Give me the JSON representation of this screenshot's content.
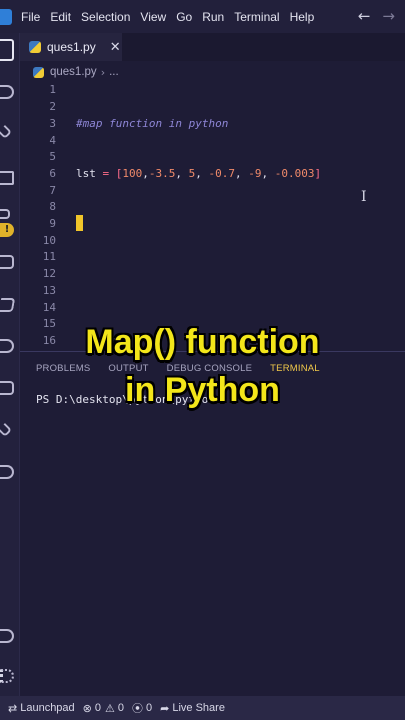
{
  "menubar": {
    "items": [
      "File",
      "Edit",
      "Selection",
      "View",
      "Go",
      "Run",
      "Terminal",
      "Help"
    ],
    "back_icon": "arrow-left-icon",
    "forward_icon": "arrow-right-icon"
  },
  "tab": {
    "label": "ques1.py",
    "close": "✕"
  },
  "breadcrumb": {
    "file": "ques1.py",
    "sep": "›",
    "more": "..."
  },
  "editor": {
    "line_numbers": [
      "1",
      "2",
      "3",
      "4",
      "5",
      "6",
      "7",
      "8",
      "9",
      "10",
      "11",
      "12",
      "13",
      "14",
      "15",
      "16"
    ],
    "line3_comment": "#map function in python",
    "line6": {
      "var": "lst",
      "op": " = ",
      "open": "[",
      "values": [
        "100",
        "-3.5",
        "5",
        "-0.7",
        "-9",
        "-0.003"
      ],
      "close": "]"
    }
  },
  "overlay": {
    "line1": "Map() function",
    "line2": "in Python"
  },
  "panel": {
    "tabs": [
      "PROBLEMS",
      "OUTPUT",
      "DEBUG CONSOLE",
      "TERMINAL"
    ],
    "active_tab": "TERMINAL",
    "terminal_text": "PS D:\\desktop\\python\\python>"
  },
  "statusbar": {
    "launchpad": "Launchpad",
    "errors": "0",
    "warnings": "0",
    "ports": "0",
    "live_share": "Live Share"
  },
  "colors": {
    "accent": "#f3e61a",
    "editor_bg": "#1e1c36",
    "cursor": "#f1c52a"
  }
}
